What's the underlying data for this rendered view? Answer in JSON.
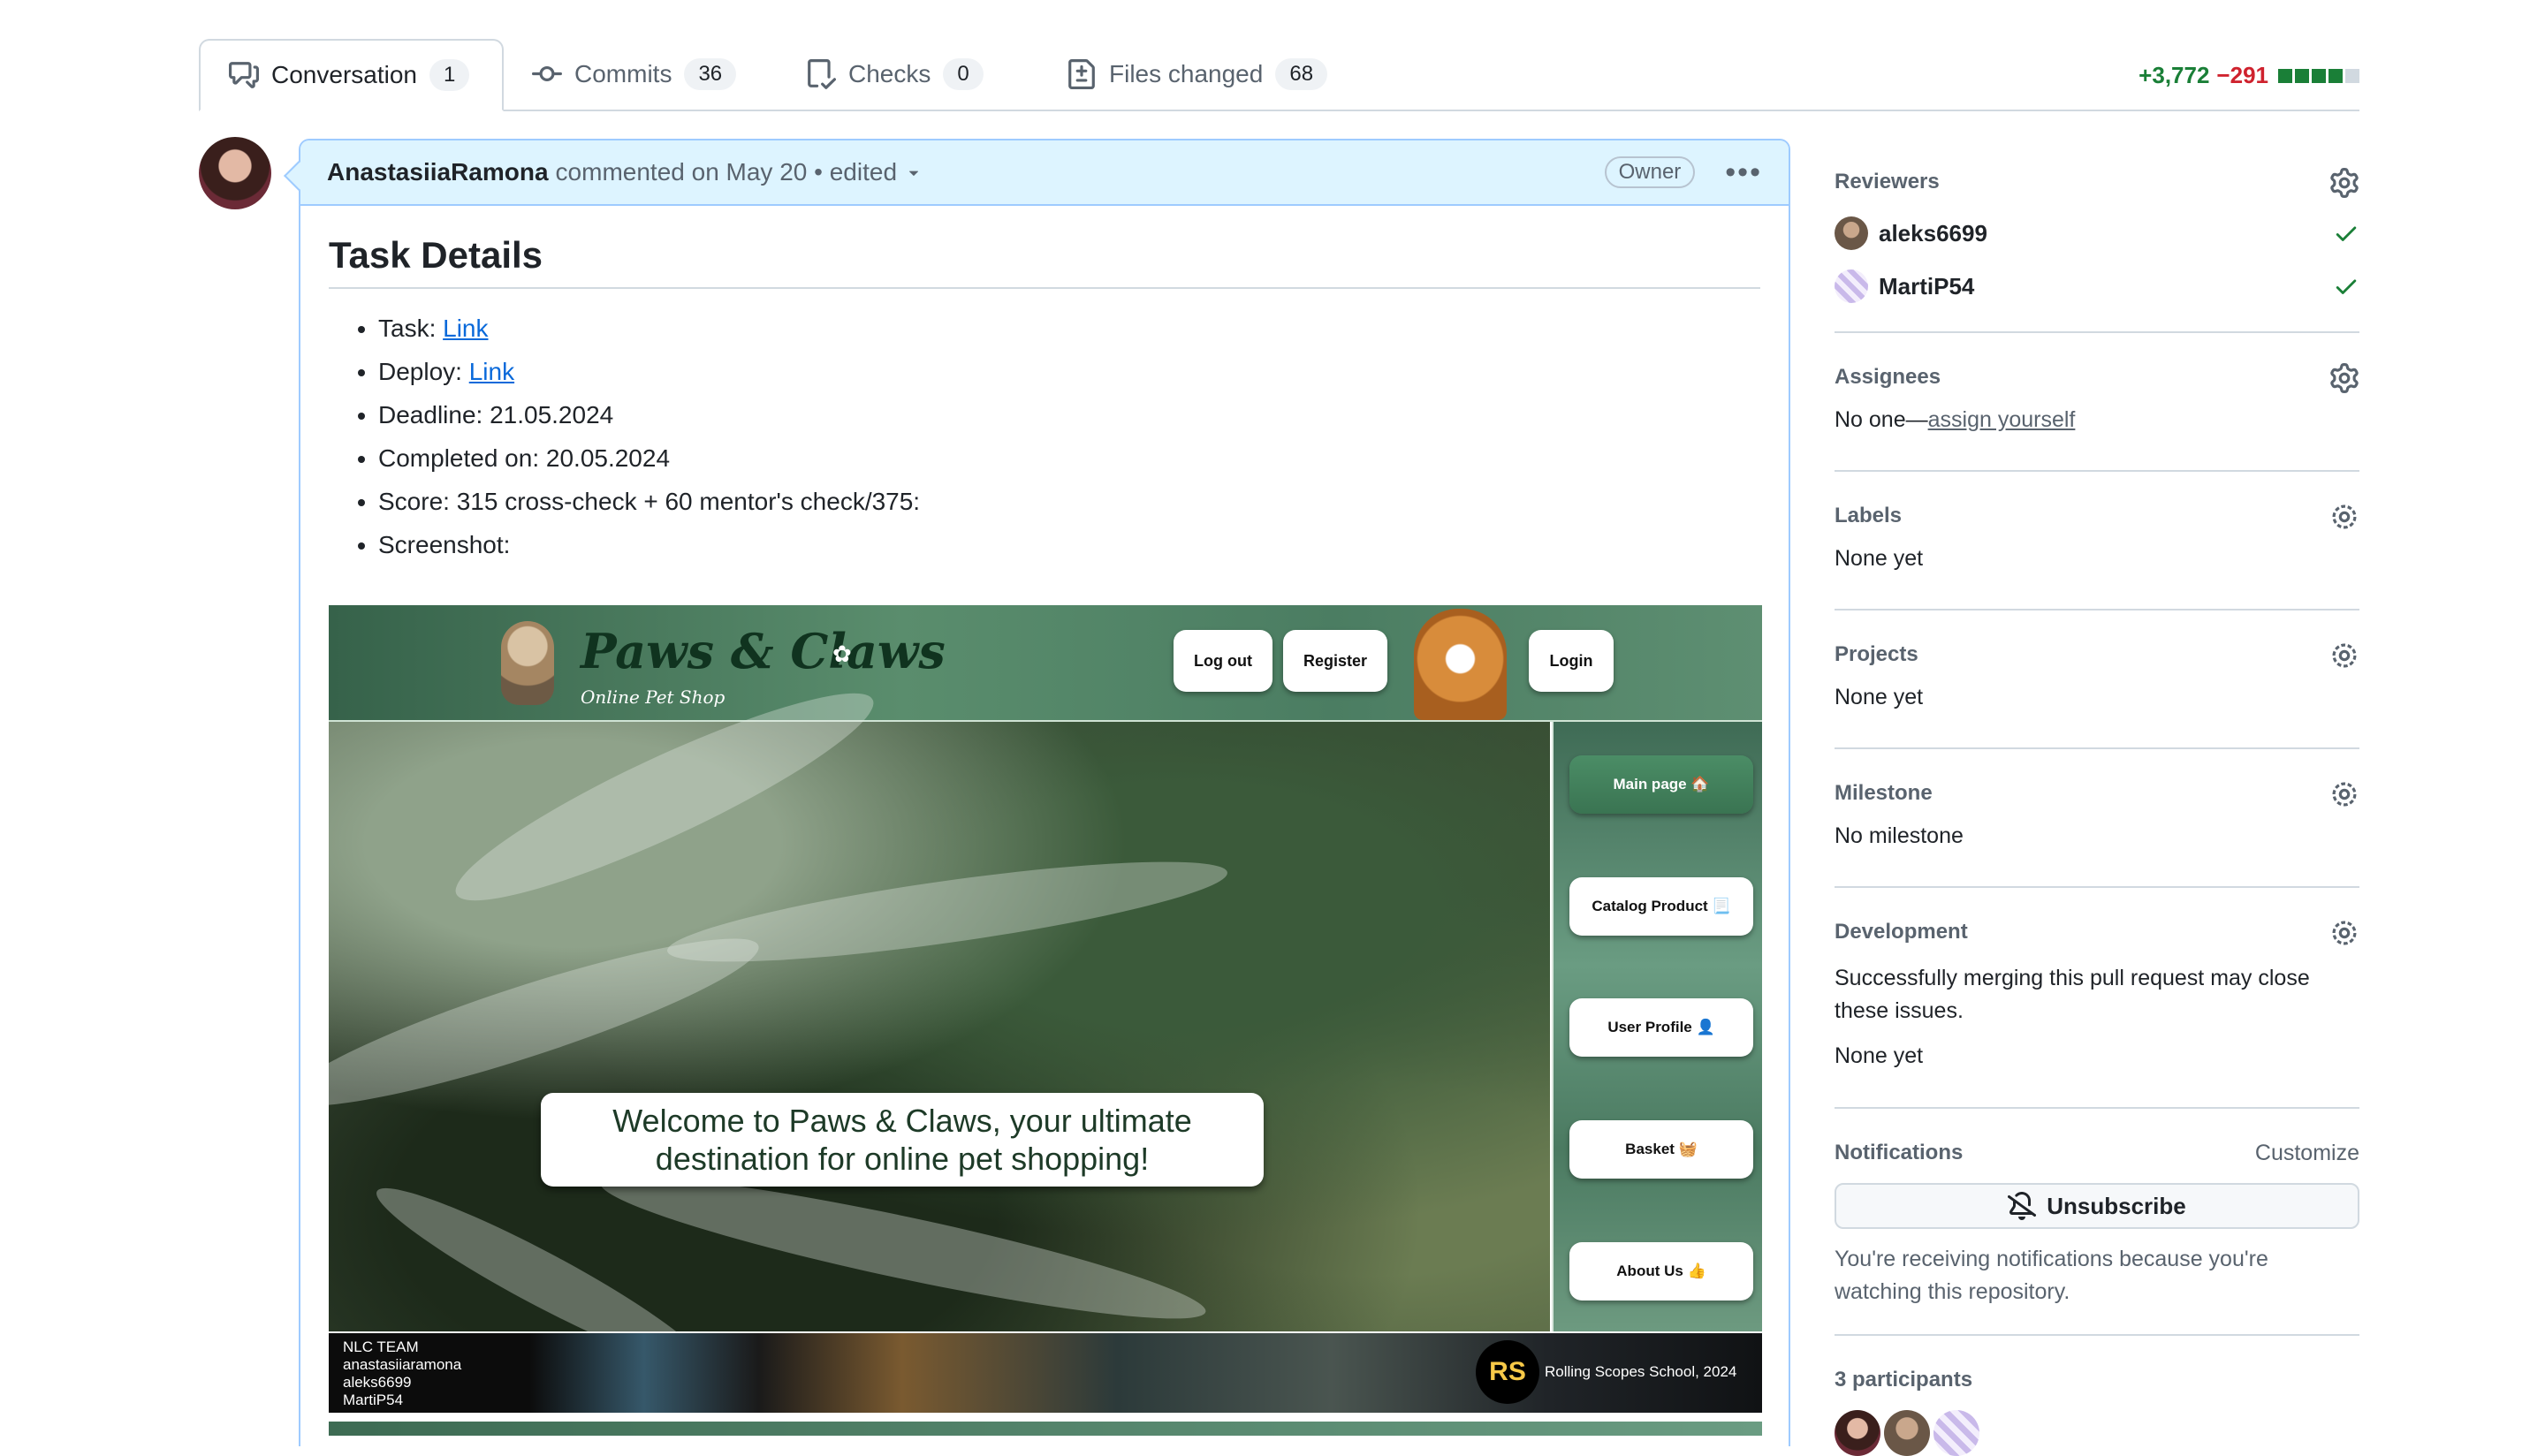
{
  "tabs": [
    {
      "label": "Conversation",
      "count": "1"
    },
    {
      "label": "Commits",
      "count": "36"
    },
    {
      "label": "Checks",
      "count": "0"
    },
    {
      "label": "Files changed",
      "count": "68"
    }
  ],
  "diffstat": {
    "additions": "+3,772",
    "deletions": "−291"
  },
  "comment": {
    "author": "AnastasiiaRamona",
    "meta": "commented on May 20 • edited",
    "role": "Owner",
    "heading": "Task Details",
    "items": [
      {
        "label": "Task: ",
        "link": "Link"
      },
      {
        "label": "Deploy: ",
        "link": "Link"
      },
      {
        "label": "Deadline: 21.05.2024"
      },
      {
        "label": "Completed on: 20.05.2024"
      },
      {
        "label": "Score: 315 cross-check + 60 mentor's check/375:"
      },
      {
        "label": "Screenshot:"
      }
    ]
  },
  "screenshot": {
    "logo": "Paws & Claws",
    "logo_sub": "Online Pet Shop",
    "top_buttons": [
      "Log out",
      "Register",
      "Login"
    ],
    "welcome": "Welcome to Paws & Claws, your ultimate destination for online pet shopping!",
    "nav": [
      "Main page 🏠",
      "Catalog Product 📃",
      "User Profile 👤",
      "Basket 🧺",
      "About Us 👍"
    ],
    "footer_team": [
      "NLC TEAM",
      "anastasiiaramona",
      "aleks6699",
      "MartiP54"
    ],
    "rs_badge": "RS",
    "footer_right": "Rolling Scopes School, 2024"
  },
  "sidebar": {
    "reviewers": {
      "title": "Reviewers",
      "people": [
        "aleks6699",
        "MartiP54"
      ]
    },
    "assignees": {
      "title": "Assignees",
      "text": "No one—",
      "link": "assign yourself"
    },
    "labels": {
      "title": "Labels",
      "text": "None yet"
    },
    "projects": {
      "title": "Projects",
      "text": "None yet"
    },
    "milestone": {
      "title": "Milestone",
      "text": "No milestone"
    },
    "development": {
      "title": "Development",
      "text": "Successfully merging this pull request may close these issues.",
      "text2": "None yet"
    },
    "notifications": {
      "title": "Notifications",
      "customize": "Customize",
      "button": "Unsubscribe",
      "note": "You're receiving notifications because you're watching this repository."
    },
    "participants": {
      "title": "3 participants"
    }
  },
  "colors": {
    "accent_link": "#0969da",
    "success": "#1a7f37",
    "danger": "#cf222e",
    "comment_header": "#ddf4ff"
  }
}
